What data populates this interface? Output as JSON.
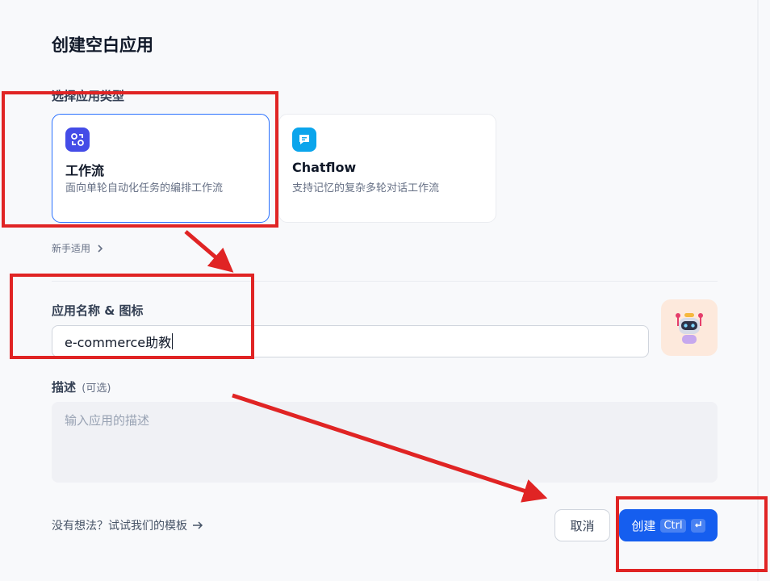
{
  "dialog": {
    "title": "创建空白应用"
  },
  "app_type": {
    "label": "选择应用类型",
    "cards": [
      {
        "title": "工作流",
        "desc": "面向单轮自动化任务的编排工作流",
        "icon": "workflow-icon",
        "color": "#444ce7",
        "selected": true
      },
      {
        "title": "Chatflow",
        "desc": "支持记忆的复杂多轮对话工作流",
        "icon": "chatflow-icon",
        "color": "#0ba5ec",
        "selected": false
      }
    ],
    "beginner": {
      "label": "新手适用",
      "icon": "chevron-right-icon"
    }
  },
  "name_section": {
    "label": "应用名称 & 图标",
    "value": "e-commerce助教",
    "avatar_icon": "robot-avatar-icon"
  },
  "description": {
    "label": "描述",
    "optional": "(可选)",
    "placeholder": "输入应用的描述"
  },
  "footer": {
    "templates_link": "没有想法？试试我们的模板",
    "templates_icon": "arrow-right-icon",
    "cancel": "取消",
    "create": "创建",
    "shortcut": "Ctrl",
    "enter_icon": "enter-key-icon"
  },
  "colors": {
    "primary": "#155eef",
    "annotation": "#e02424"
  }
}
